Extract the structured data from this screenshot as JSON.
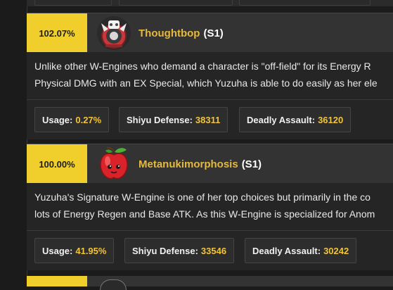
{
  "engines": [
    {
      "percent": "102.07%",
      "name": "Thoughtbop",
      "rank": "(S1)",
      "icon": "thoughtbop-wengine-icon",
      "description": [
        "Unlike other W-Engines who demand a character is \"off-field\" for its Energy R",
        "Physical DMG with an EX Special, which Yuzuha is able to do easily as her ele"
      ],
      "stats": [
        {
          "label": "Usage:",
          "value": "0.27%"
        },
        {
          "label": "Shiyu Defense:",
          "value": "38311"
        },
        {
          "label": "Deadly Assault:",
          "value": "36120"
        }
      ]
    },
    {
      "percent": "100.00%",
      "name": "Metanukimorphosis",
      "rank": "(S1)",
      "icon": "metanukimorphosis-apple-icon",
      "description": [
        "Yuzuha's Signature W-Engine is one of her top choices but primarily in the co",
        "lots of Energy Regen and Base ATK. As this W-Engine is specialized for Anom"
      ],
      "stats": [
        {
          "label": "Usage:",
          "value": "41.95%"
        },
        {
          "label": "Shiyu Defense:",
          "value": "33546"
        },
        {
          "label": "Deadly Assault:",
          "value": "30242"
        }
      ]
    }
  ],
  "colors": {
    "accent": "#f0ce2c",
    "name": "#e6b93d",
    "value": "#f0c43c",
    "header_bg": "#333333",
    "body_bg": "#252525"
  }
}
